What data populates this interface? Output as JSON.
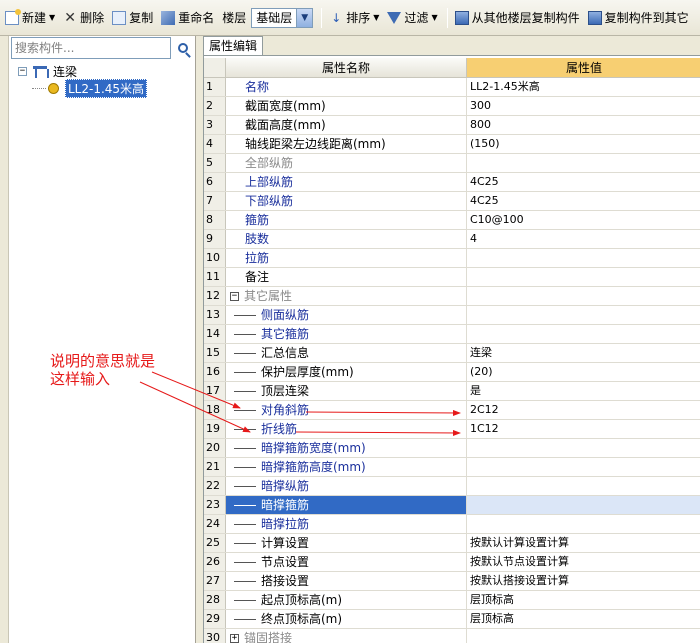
{
  "toolbar": {
    "new_label": "新建",
    "delete_label": "删除",
    "copy_label": "复制",
    "rename_label": "重命名",
    "floor_label": "楼层",
    "floor_value": "基础层",
    "sort_label": "排序",
    "filter_label": "过滤",
    "copy_from_label": "从其他楼层复制构件",
    "copy_to_label": "复制构件到其它"
  },
  "search": {
    "placeholder": "搜索构件..."
  },
  "tree": {
    "root_label": "连梁",
    "child_label": "LL2-1.45米高"
  },
  "tab_label": "属性编辑",
  "grid": {
    "col_name": "属性名称",
    "col_value": "属性值",
    "rows": [
      {
        "n": "1",
        "name": "名称",
        "value": "LL2-1.45米高"
      },
      {
        "n": "2",
        "name": "截面宽度(mm)",
        "value": "300"
      },
      {
        "n": "3",
        "name": "截面高度(mm)",
        "value": "800"
      },
      {
        "n": "4",
        "name": "轴线距梁左边线距离(mm)",
        "value": "(150)"
      },
      {
        "n": "5",
        "name": "全部纵筋",
        "value": ""
      },
      {
        "n": "6",
        "name": "上部纵筋",
        "value": "4C25"
      },
      {
        "n": "7",
        "name": "下部纵筋",
        "value": "4C25"
      },
      {
        "n": "8",
        "name": "箍筋",
        "value": "C10@100"
      },
      {
        "n": "9",
        "name": "肢数",
        "value": "4"
      },
      {
        "n": "10",
        "name": "拉筋",
        "value": ""
      },
      {
        "n": "11",
        "name": "备注",
        "value": ""
      },
      {
        "n": "12",
        "name": "其它属性",
        "value": ""
      },
      {
        "n": "13",
        "name": "侧面纵筋",
        "value": ""
      },
      {
        "n": "14",
        "name": "其它箍筋",
        "value": ""
      },
      {
        "n": "15",
        "name": "汇总信息",
        "value": "连梁"
      },
      {
        "n": "16",
        "name": "保护层厚度(mm)",
        "value": "(20)"
      },
      {
        "n": "17",
        "name": "顶层连梁",
        "value": "是"
      },
      {
        "n": "18",
        "name": "对角斜筋",
        "value": "2C12"
      },
      {
        "n": "19",
        "name": "折线筋",
        "value": "1C12"
      },
      {
        "n": "20",
        "name": "暗撑箍筋宽度(mm)",
        "value": ""
      },
      {
        "n": "21",
        "name": "暗撑箍筋高度(mm)",
        "value": ""
      },
      {
        "n": "22",
        "name": "暗撑纵筋",
        "value": ""
      },
      {
        "n": "23",
        "name": "暗撑箍筋",
        "value": ""
      },
      {
        "n": "24",
        "name": "暗撑拉筋",
        "value": ""
      },
      {
        "n": "25",
        "name": "计算设置",
        "value": "按默认计算设置计算"
      },
      {
        "n": "26",
        "name": "节点设置",
        "value": "按默认节点设置计算"
      },
      {
        "n": "27",
        "name": "搭接设置",
        "value": "按默认搭接设置计算"
      },
      {
        "n": "28",
        "name": "起点顶标高(m)",
        "value": "层顶标高"
      },
      {
        "n": "29",
        "name": "终点顶标高(m)",
        "value": "层顶标高"
      },
      {
        "n": "30",
        "name": "锚固搭接",
        "value": ""
      }
    ]
  },
  "annotation": {
    "text": "说明的意思就是\n这样输入",
    "color": "#e61919"
  },
  "colors": {
    "value_header": "#f7cf72",
    "selection": "#316ac5",
    "blue_text": "#1a2f9c"
  }
}
